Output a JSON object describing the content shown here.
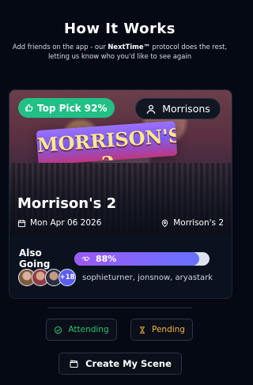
{
  "header": {
    "title": "How It Works",
    "subtitle_line1_prefix": "Add friends on the app - our ",
    "subtitle_brand": "NextTime™",
    "subtitle_line1_suffix": " protocol does the rest,",
    "subtitle_line2": "letting us know who you'd like to see again"
  },
  "card": {
    "badge": {
      "label": "Top Pick 92%",
      "icon": "thumbs-up-icon",
      "color": "#22c086"
    },
    "location_pill": {
      "label": "Morrisons",
      "icon": "user-icon"
    },
    "hero_sign_text": "MORRISON'S 2",
    "venue_name": "Morrison's 2",
    "date": "Mon Apr 06 2026",
    "place": "Morrison's 2",
    "also_going_label": "Also Going",
    "going_percent_label": "88%",
    "going_progress": 0.88,
    "friends": {
      "more_count": "+18",
      "names": "sophieturner, jonsnow, aryastark"
    }
  },
  "actions": {
    "attending_label": "Attending",
    "pending_label": "Pending",
    "create_label": "Create My Scene"
  },
  "colors": {
    "background": "#050913",
    "badge_green": "#22c086",
    "attending_green": "#2cc276",
    "pending_amber": "#f3b63f",
    "progress_start": "#9c5af5",
    "progress_end": "#6772ff"
  }
}
